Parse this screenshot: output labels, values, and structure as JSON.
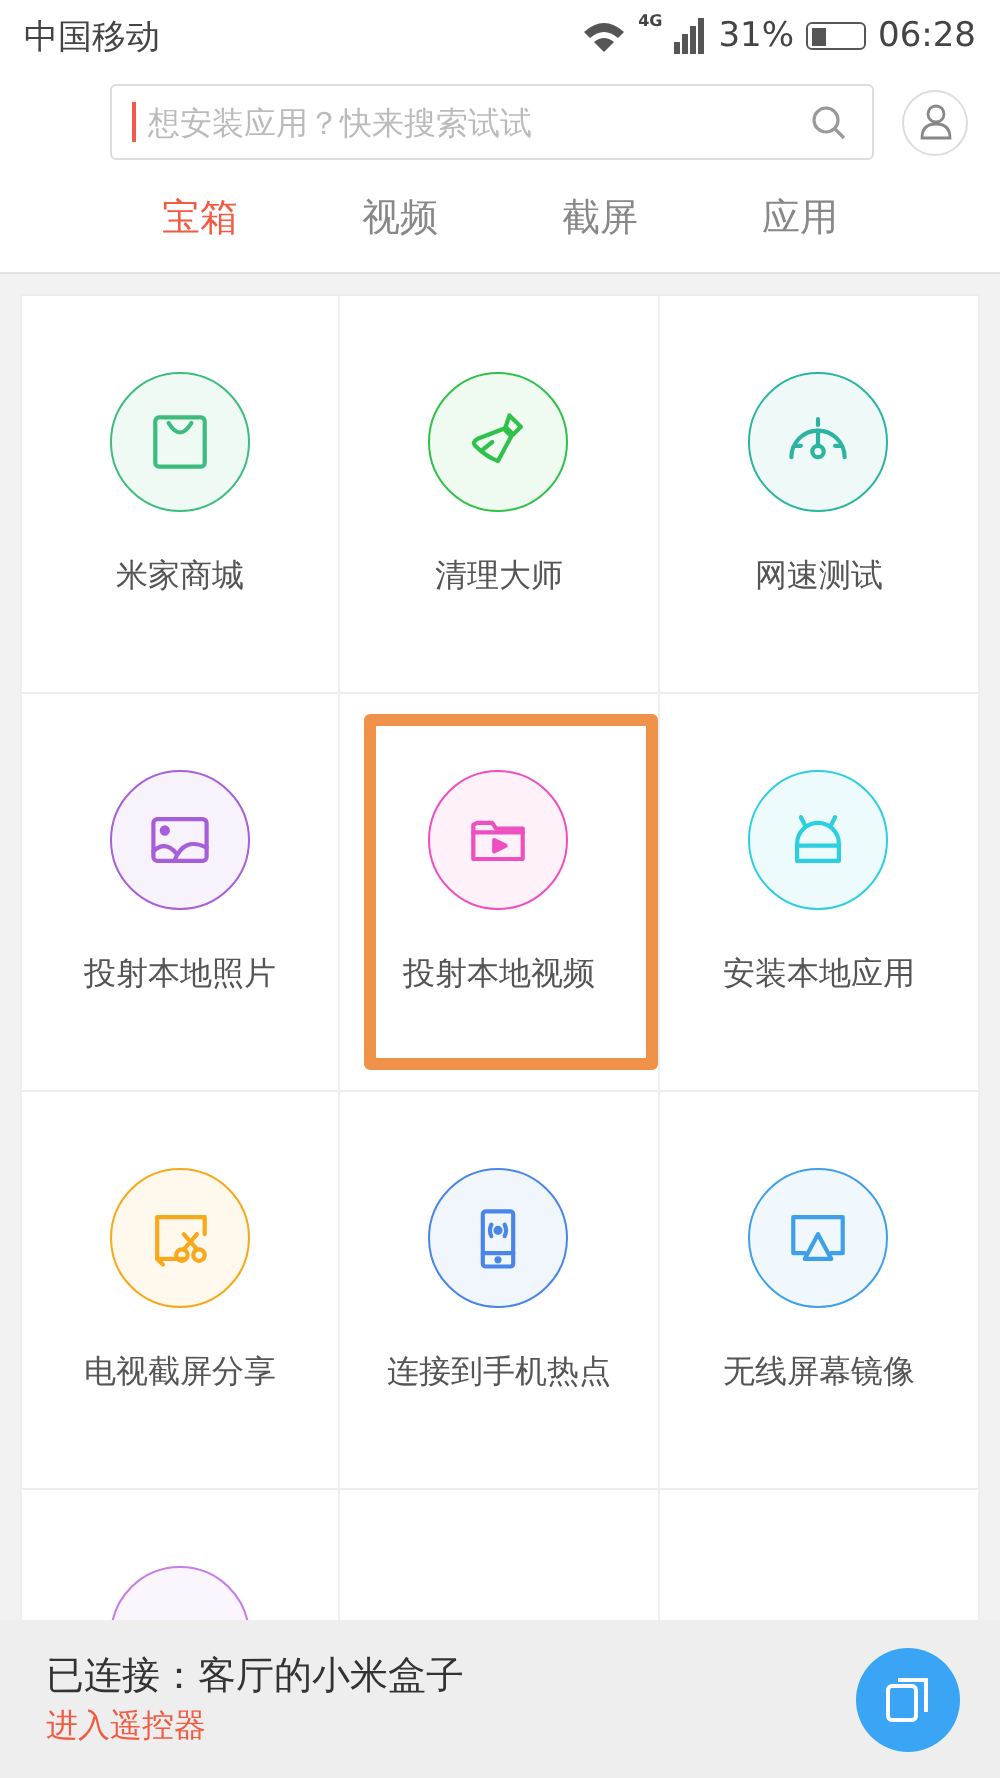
{
  "status_bar": {
    "carrier": "中国移动",
    "network": "4G",
    "battery": "31%",
    "time": "06:28"
  },
  "search": {
    "placeholder": "想安装应用？快来搜索试试"
  },
  "tabs": [
    {
      "label": "宝箱",
      "selected": true
    },
    {
      "label": "视频",
      "selected": false
    },
    {
      "label": "截屏",
      "selected": false
    },
    {
      "label": "应用",
      "selected": false
    }
  ],
  "tools": [
    {
      "label": "米家商城",
      "kind": "bag",
      "color": "#3dbd7d",
      "highlighted": false
    },
    {
      "label": "清理大师",
      "kind": "brush",
      "color": "#2fc14a",
      "highlighted": false
    },
    {
      "label": "网速测试",
      "kind": "gauge",
      "color": "#2bb5a0",
      "highlighted": false
    },
    {
      "label": "投射本地照片",
      "kind": "photo",
      "color": "#a65fd8",
      "highlighted": false
    },
    {
      "label": "投射本地视频",
      "kind": "video",
      "color": "#ee4fc0",
      "highlighted": true
    },
    {
      "label": "安装本地应用",
      "kind": "android",
      "color": "#2ccfe0",
      "highlighted": false
    },
    {
      "label": "电视截屏分享",
      "kind": "scissors",
      "color": "#f7a81b",
      "highlighted": false
    },
    {
      "label": "连接到手机热点",
      "kind": "phone",
      "color": "#4a86e8",
      "highlighted": false
    },
    {
      "label": "无线屏幕镜像",
      "kind": "airplay",
      "color": "#3ea0ea",
      "highlighted": false
    },
    {
      "kind": "partial",
      "color": "#c77ce8",
      "highlighted": false
    }
  ],
  "bottom_bar": {
    "status": "已连接：客厅的小米盒子",
    "link": "进入遥控器"
  }
}
